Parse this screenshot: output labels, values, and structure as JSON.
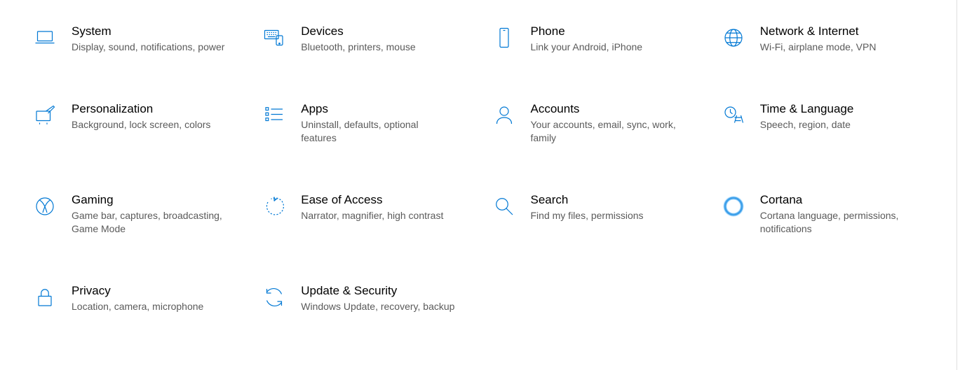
{
  "accent": "#0078d4",
  "categories": [
    {
      "id": "system",
      "title": "System",
      "desc": "Display, sound, notifications, power",
      "icon": "laptop-icon"
    },
    {
      "id": "devices",
      "title": "Devices",
      "desc": "Bluetooth, printers, mouse",
      "icon": "keyboard-icon"
    },
    {
      "id": "phone",
      "title": "Phone",
      "desc": "Link your Android, iPhone",
      "icon": "phone-icon"
    },
    {
      "id": "network",
      "title": "Network & Internet",
      "desc": "Wi-Fi, airplane mode, VPN",
      "icon": "globe-icon"
    },
    {
      "id": "personalization",
      "title": "Personalization",
      "desc": "Background, lock screen, colors",
      "icon": "paintbrush-icon"
    },
    {
      "id": "apps",
      "title": "Apps",
      "desc": "Uninstall, defaults, optional features",
      "icon": "list-icon"
    },
    {
      "id": "accounts",
      "title": "Accounts",
      "desc": "Your accounts, email, sync, work, family",
      "icon": "person-icon"
    },
    {
      "id": "time",
      "title": "Time & Language",
      "desc": "Speech, region, date",
      "icon": "clock-language-icon"
    },
    {
      "id": "gaming",
      "title": "Gaming",
      "desc": "Game bar, captures, broadcasting, Game Mode",
      "icon": "xbox-icon"
    },
    {
      "id": "ease",
      "title": "Ease of Access",
      "desc": "Narrator, magnifier, high contrast",
      "icon": "ease-of-access-icon"
    },
    {
      "id": "search",
      "title": "Search",
      "desc": "Find my files, permissions",
      "icon": "search-icon"
    },
    {
      "id": "cortana",
      "title": "Cortana",
      "desc": "Cortana language, permissions, notifications",
      "icon": "cortana-icon"
    },
    {
      "id": "privacy",
      "title": "Privacy",
      "desc": "Location, camera, microphone",
      "icon": "lock-icon"
    },
    {
      "id": "update",
      "title": "Update & Security",
      "desc": "Windows Update, recovery, backup",
      "icon": "sync-icon"
    }
  ]
}
